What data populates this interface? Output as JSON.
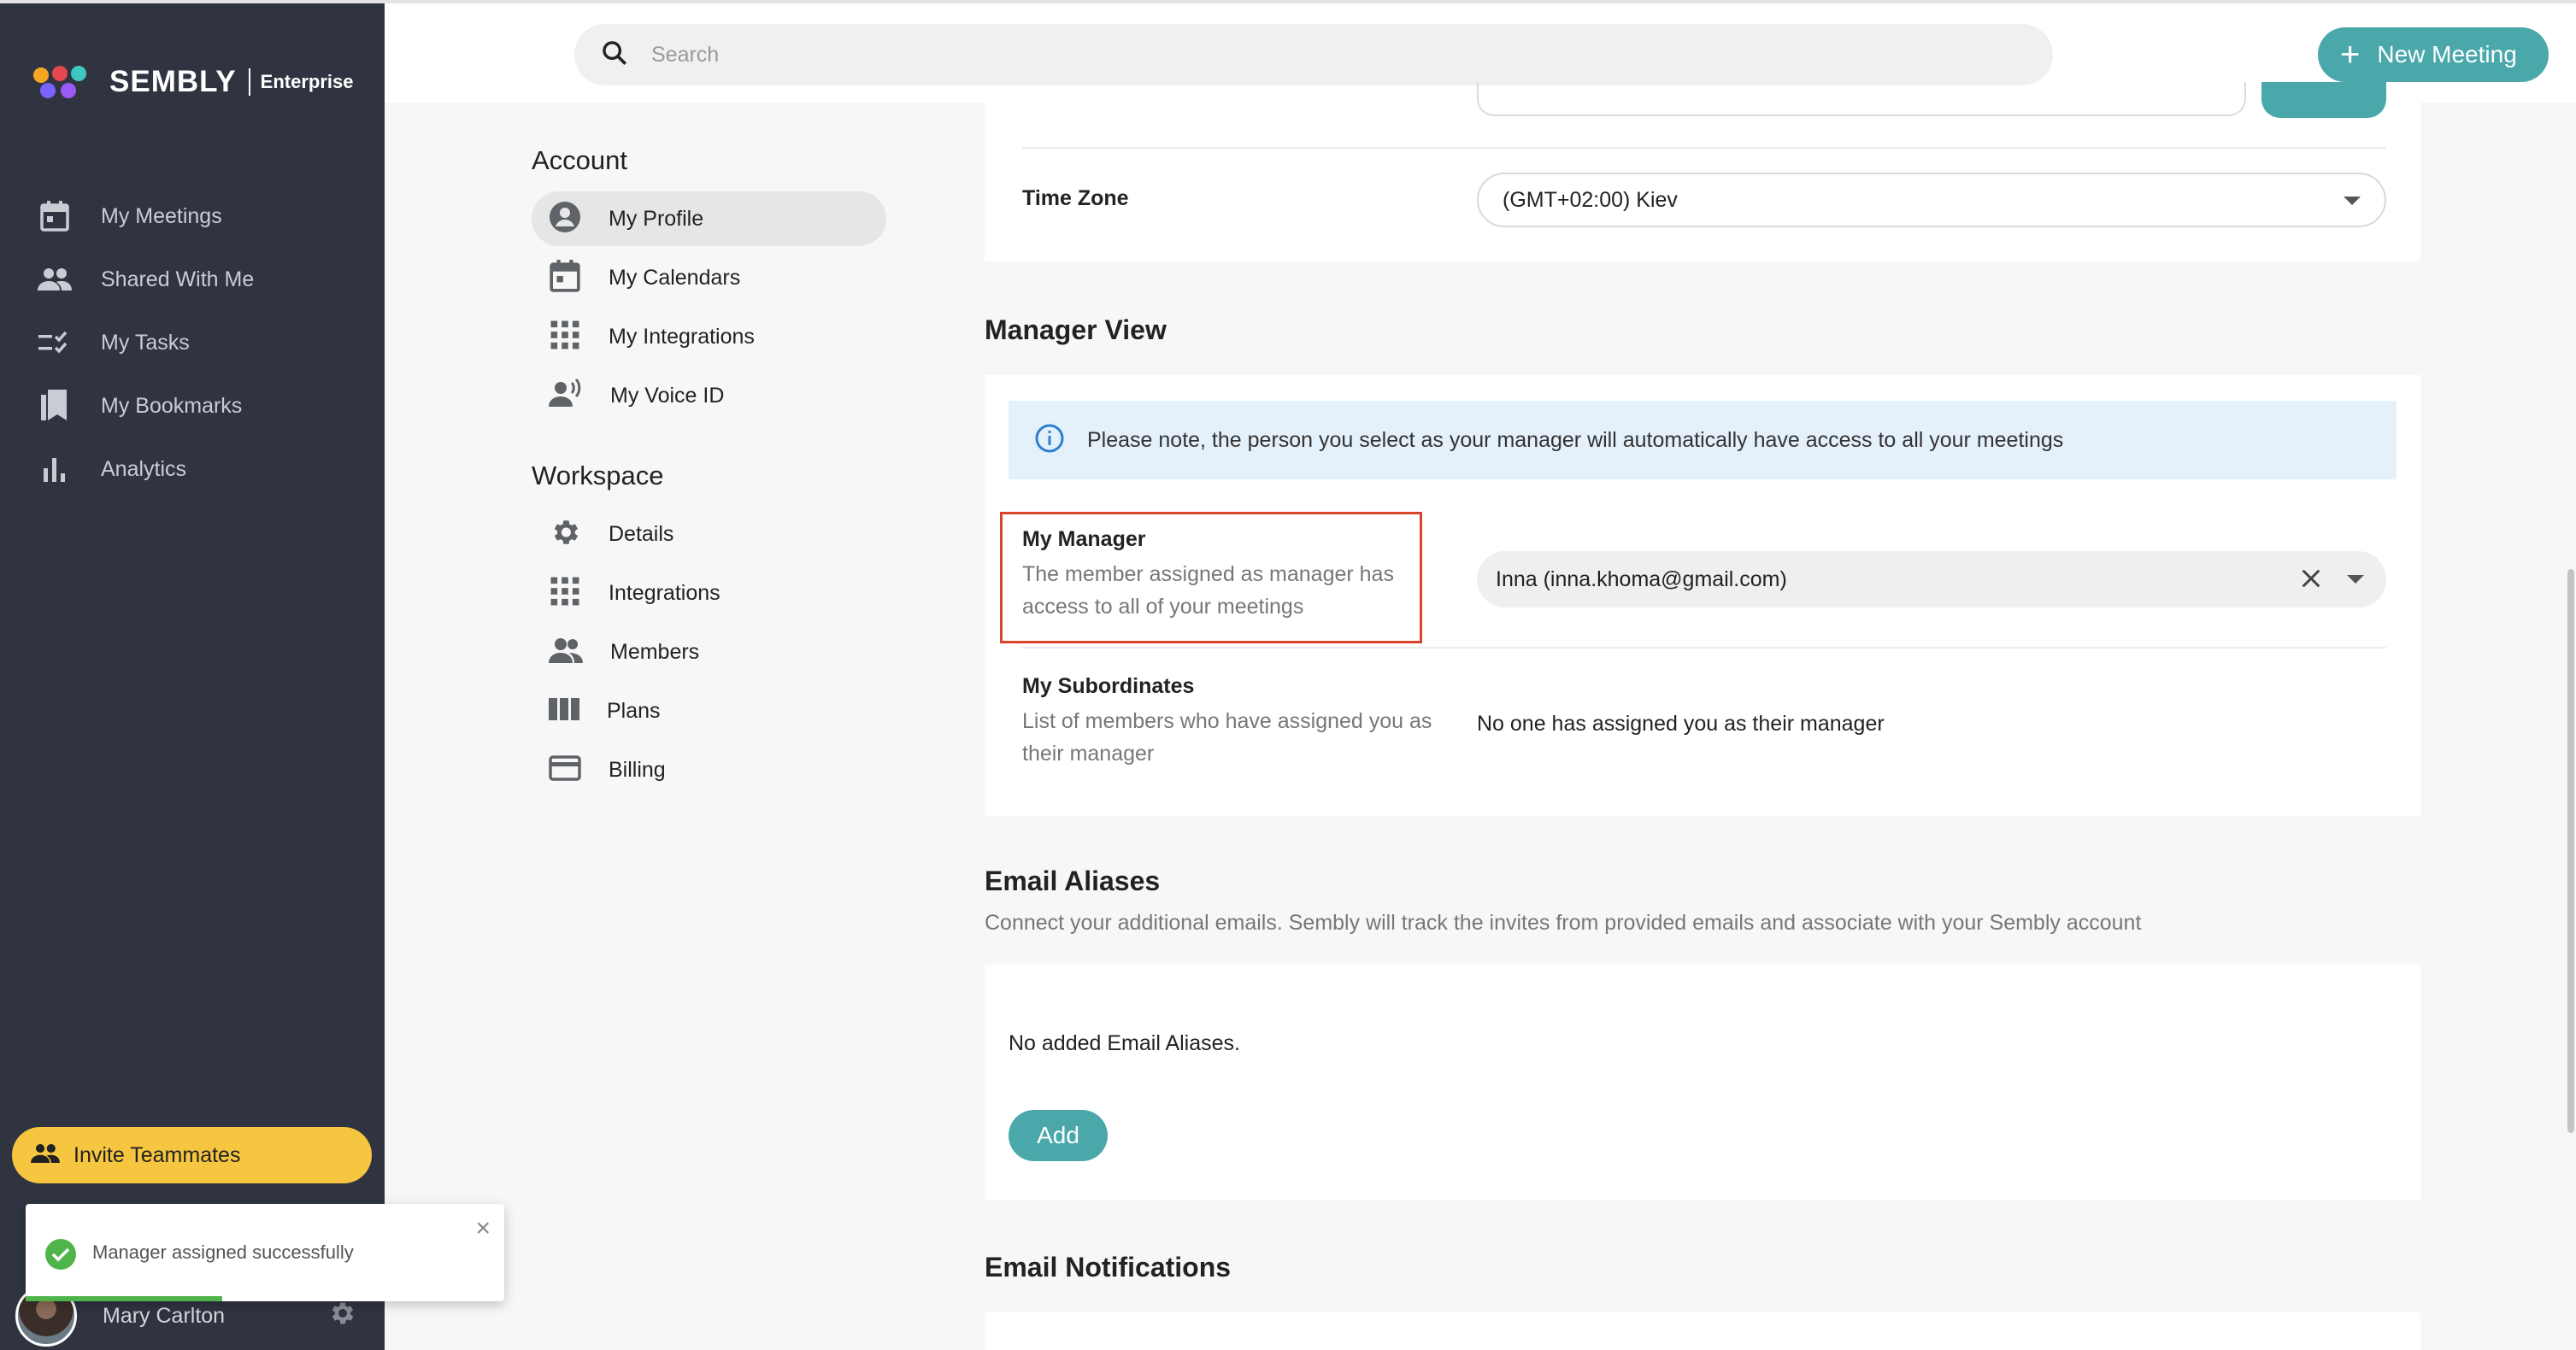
{
  "app": {
    "brand": "SEMBLY",
    "edition": "Enterprise",
    "colors": {
      "sidebar": "#303441",
      "accent": "#4aa8ab",
      "invite": "#f7c640",
      "highlight_border": "#d9452a",
      "success": "#4fb54a"
    }
  },
  "sidebar": {
    "items": [
      {
        "label": "My Meetings",
        "icon": "calendar-icon"
      },
      {
        "label": "Shared With Me",
        "icon": "people-icon"
      },
      {
        "label": "My Tasks",
        "icon": "tasks-icon"
      },
      {
        "label": "My Bookmarks",
        "icon": "bookmarks-icon"
      },
      {
        "label": "Analytics",
        "icon": "analytics-icon"
      }
    ],
    "invite_label": "Invite Teammates",
    "user_name": "Mary Carlton"
  },
  "toast": {
    "message": "Manager assigned successfully",
    "close": "×"
  },
  "topbar": {
    "search_placeholder": "Search",
    "new_meeting_label": "New Meeting",
    "new_meeting_icon": "+"
  },
  "settings_nav": {
    "account_title": "Account",
    "account_items": [
      {
        "label": "My Profile",
        "icon": "account-circle-icon",
        "active": true
      },
      {
        "label": "My Calendars",
        "icon": "calendar-icon"
      },
      {
        "label": "My Integrations",
        "icon": "grid-icon"
      },
      {
        "label": "My Voice ID",
        "icon": "voice-id-icon"
      }
    ],
    "workspace_title": "Workspace",
    "workspace_items": [
      {
        "label": "Details",
        "icon": "gear-icon"
      },
      {
        "label": "Integrations",
        "icon": "grid-icon"
      },
      {
        "label": "Members",
        "icon": "members-icon"
      },
      {
        "label": "Plans",
        "icon": "plans-icon"
      },
      {
        "label": "Billing",
        "icon": "credit-card-icon"
      }
    ]
  },
  "profile": {
    "time_zone_label": "Time Zone",
    "time_zone_value": "(GMT+02:00) Kiev"
  },
  "manager_view": {
    "title": "Manager View",
    "notice": "Please note, the person you select as your manager will automatically have access to all your meetings",
    "my_manager_title": "My Manager",
    "my_manager_desc": "The member assigned as manager has access to all of your meetings",
    "my_manager_value": "Inna (inna.khoma@gmail.com)",
    "subordinates_title": "My Subordinates",
    "subordinates_desc": "List of members who have assigned you as their manager",
    "subordinates_value": "No one has assigned you as their manager"
  },
  "email_aliases": {
    "title": "Email Aliases",
    "subtitle": "Connect your additional emails. Sembly will track the invites from provided emails and associate with your Sembly account",
    "empty": "No added Email Aliases.",
    "add_label": "Add"
  },
  "email_notifications": {
    "title": "Email Notifications"
  }
}
